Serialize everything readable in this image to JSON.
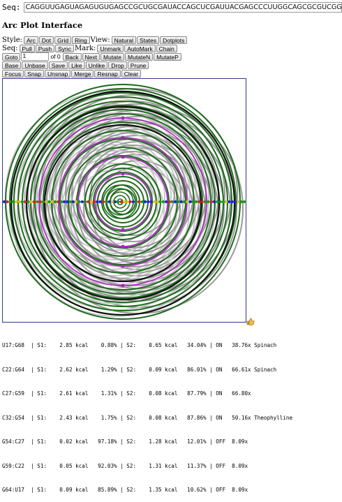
{
  "seq": {
    "label": "Seq:",
    "value": "CAGGUUGAGUAGAGUGUGAGCCGCUGCGAUACCAGCUCGAUUACGAGCCCUUGGCAGCGCGUCGGAAGGACGGGUCCCUGG"
  },
  "title": "Arc Plot Interface",
  "style_row": {
    "label": "Style:",
    "buttons": [
      "Arc",
      "Dot",
      "Grid",
      "Ring"
    ],
    "view_label": "View:",
    "view_buttons": [
      "Natural",
      "States",
      "Dotplots"
    ]
  },
  "seq_row": {
    "label": "Seq:",
    "buttons": [
      "Pull",
      "Push",
      "Sync"
    ],
    "mark_label": "Mark:",
    "mark_buttons": [
      "Unmark",
      "AutoMark",
      "Chain"
    ]
  },
  "goto_row": {
    "goto": "Goto",
    "value": "1",
    "of": "of 0",
    "buttons": [
      "Back",
      "Next",
      "Mutate",
      "MutateN",
      "MutateP"
    ]
  },
  "base_row": {
    "buttons": [
      "Base",
      "Unbase",
      "Save",
      "Like",
      "Unlike",
      "Drop",
      "Prune"
    ]
  },
  "focus_row": {
    "buttons": [
      "Focus",
      "Snap",
      "Unsnap",
      "Merge",
      "Resnap",
      "Clear"
    ]
  },
  "colors": {
    "green": "#1f6b1f",
    "black": "#111111",
    "gray": "#9a9a9a",
    "lightgray": "#c8c8c8",
    "magenta": "#b020c8",
    "border": "#2b3a8c"
  },
  "resize_icon": "thumb-icon",
  "table": [
    "U17:G68  | S1:    2.85 kcal    0.88% | S2:    0.65 kcal   34.04% | ON   38.76x Spinach",
    "C22:G64  | S1:    2.62 kcal    1.29% | S2:    0.09 kcal   86.01% | ON   66.61x Spinach",
    "C27:G59  | S1:    2.61 kcal    1.31% | S2:    0.08 kcal   87.79% | ON   66.80x",
    "C32:G54  | S1:    2.43 kcal    1.75% | S2:    0.08 kcal   87.86% | ON   50.16x Theophylline",
    "G54:C27  | S1:    0.02 kcal   97.18% | S2:    1.28 kcal   12.01% | OFF  8.09x",
    "G59:C22  | S1:    0.05 kcal   92.03% | S2:    1.31 kcal   11.37% | OFF  8.09x",
    "G64:U17  | S1:    0.09 kcal   85.89% | S2:    1.35 kcal   10.62% | OFF  8.09x"
  ]
}
